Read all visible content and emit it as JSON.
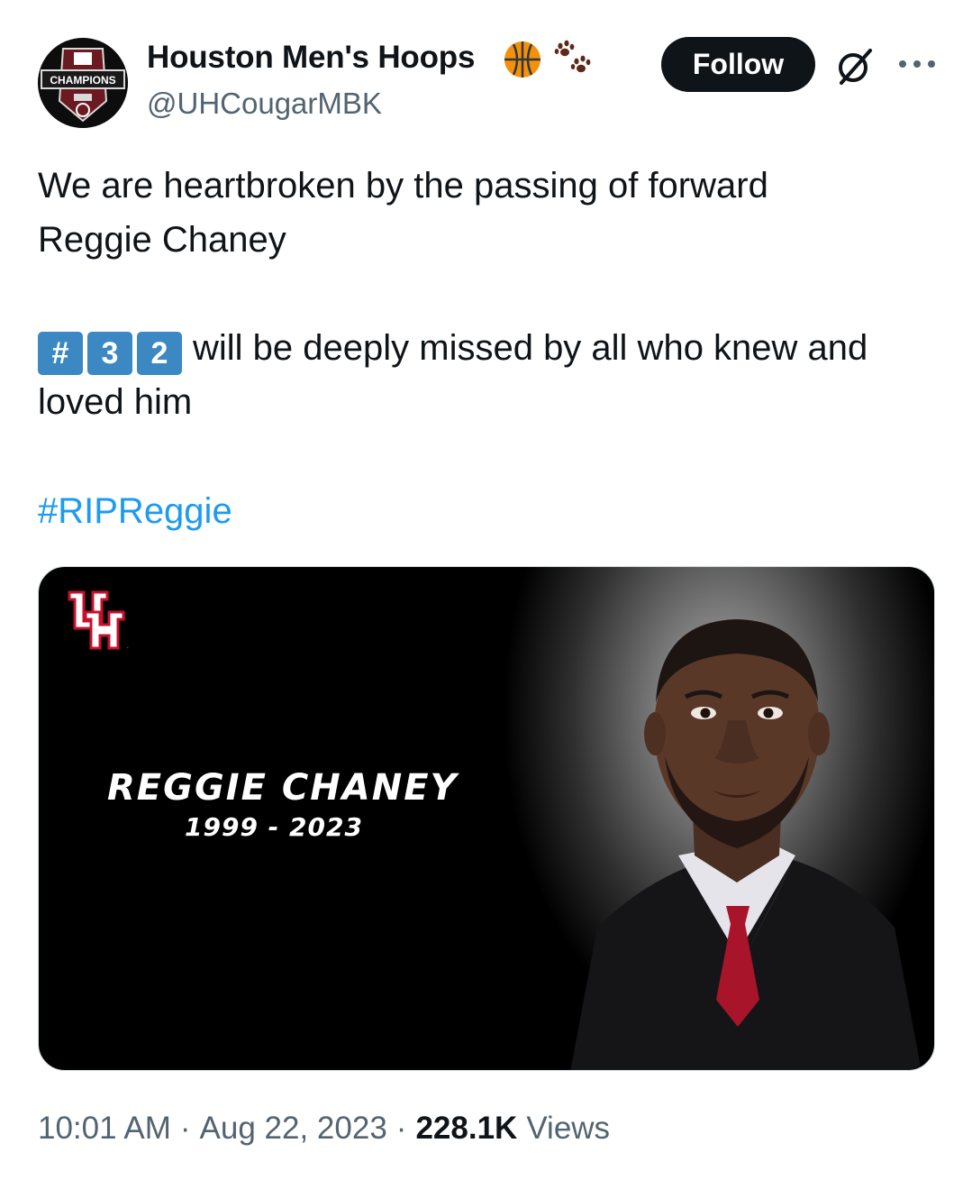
{
  "author": {
    "display_name": "Houston Men's Hoops",
    "handle": "@UHCougarMBK",
    "avatar_text": "CHAMPIONS",
    "badges": [
      "basketball-emoji",
      "paw-prints-emoji"
    ]
  },
  "actions": {
    "follow_label": "Follow",
    "grok_icon": "grok-icon",
    "more_icon": "more-options-icon"
  },
  "tweet": {
    "line1": "We are heartbroken by the passing of forward",
    "line2": "Reggie Chaney",
    "keycaps": [
      "#",
      "3",
      "2"
    ],
    "line3_rest": "will be deeply missed by all who knew and",
    "line4": "loved him",
    "hashtag": "#RIPReggie"
  },
  "media": {
    "name": "REGGIE CHANEY",
    "years": "1999 - 2023",
    "logo": "UH"
  },
  "meta": {
    "time": "10:01 AM",
    "separator": "·",
    "date": "Aug 22, 2023",
    "views_count": "228.1K",
    "views_label": "Views"
  },
  "colors": {
    "link": "#1d9bf0",
    "secondary_text": "#536471",
    "primary_text": "#0f1419",
    "keycap": "#3b88c3",
    "uh_red": "#c8102e"
  }
}
